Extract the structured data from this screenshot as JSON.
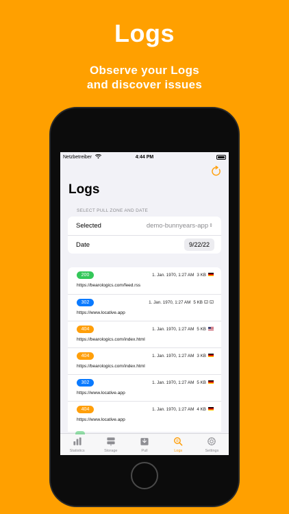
{
  "promo": {
    "title": "Logs",
    "subtitle_line1": "Observe your Logs",
    "subtitle_line2": "and discover issues"
  },
  "statusbar": {
    "carrier": "Netzbetreiber",
    "time": "4:44 PM"
  },
  "page": {
    "title": "Logs"
  },
  "selection": {
    "header": "SELECT PULL ZONE AND DATE",
    "selected_label": "Selected",
    "selected_value": "demo-bunnyears-app",
    "date_label": "Date",
    "date_value": "9/22/22"
  },
  "logs": [
    {
      "status": "200",
      "timestamp": "1. Jan. 1970, 1:27 AM",
      "size": "3 KB",
      "flag": "de",
      "url": "https://bearologics.com/feed.rss"
    },
    {
      "status": "302",
      "timestamp": "1. Jan. 1970, 1:27 AM",
      "size": "5 KB",
      "flag": "uk",
      "url": "https://www.locative.app"
    },
    {
      "status": "404",
      "timestamp": "1. Jan. 1970, 1:27 AM",
      "size": "5 KB",
      "flag": "us",
      "url": "https://bearologics.com/index.html"
    },
    {
      "status": "404",
      "timestamp": "1. Jan. 1970, 1:27 AM",
      "size": "3 KB",
      "flag": "de",
      "url": "https://bearologics.com/index.html"
    },
    {
      "status": "302",
      "timestamp": "1. Jan. 1970, 1:27 AM",
      "size": "5 KB",
      "flag": "de",
      "url": "https://www.locative.app"
    },
    {
      "status": "404",
      "timestamp": "1. Jan. 1970, 1:27 AM",
      "size": "4 KB",
      "flag": "de",
      "url": "https://www.locative.app"
    }
  ],
  "tabs": [
    {
      "label": "Statistics",
      "icon": "bar-chart-icon",
      "active": false
    },
    {
      "label": "Storage",
      "icon": "server-icon",
      "active": false
    },
    {
      "label": "Pull",
      "icon": "download-tray-icon",
      "active": false
    },
    {
      "label": "Logs",
      "icon": "magnifier-log-icon",
      "active": true
    },
    {
      "label": "Settings",
      "icon": "gear-icon",
      "active": false
    }
  ],
  "colors": {
    "background": "#FFA000",
    "accent": "#FF9F0A",
    "status_ok": "#34C759",
    "status_redirect": "#0A7AFF",
    "status_notfound": "#FF9F0A"
  }
}
